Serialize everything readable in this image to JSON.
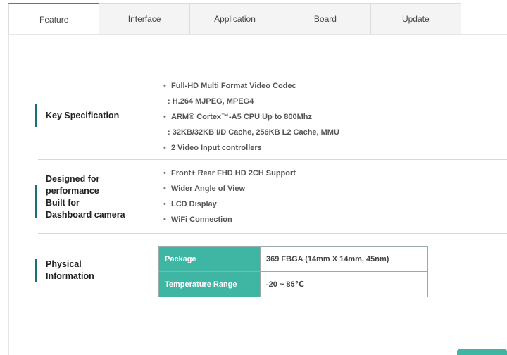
{
  "tabs": [
    {
      "label": "Feature",
      "active": true
    },
    {
      "label": "Interface",
      "active": false
    },
    {
      "label": "Application",
      "active": false
    },
    {
      "label": "Board",
      "active": false
    },
    {
      "label": "Update",
      "active": false
    }
  ],
  "sections": {
    "key_spec": {
      "title": "Key Specification",
      "items": [
        "Full-HD Multi Format Video Codec",
        ": H.264 MJPEG, MPEG4",
        "ARM® Cortex™-A5 CPU Up to 800Mhz",
        ": 32KB/32KB I/D Cache, 256KB L2 Cache, MMU",
        "2 Video Input controllers"
      ]
    },
    "performance": {
      "title": "Designed for\nperformance\nBuilt for\nDashboard camera",
      "items": [
        "Front+ Rear FHD HD 2CH Support",
        "Wider Angle of View",
        "LCD Display",
        "WiFi Connection"
      ]
    },
    "physical": {
      "title": "Physical\nInformation",
      "rows": [
        {
          "key": "Package",
          "value": "369 FBGA (14mm X 14mm, 45nm)"
        },
        {
          "key": "Temperature Range",
          "value": "-20 ~ 85℃"
        }
      ]
    }
  },
  "bullet": "•",
  "colors": {
    "accent_bar": "#1a6f78",
    "table_key_bg": "#3fb5a3",
    "active_tab_border": "#3a8a92"
  }
}
